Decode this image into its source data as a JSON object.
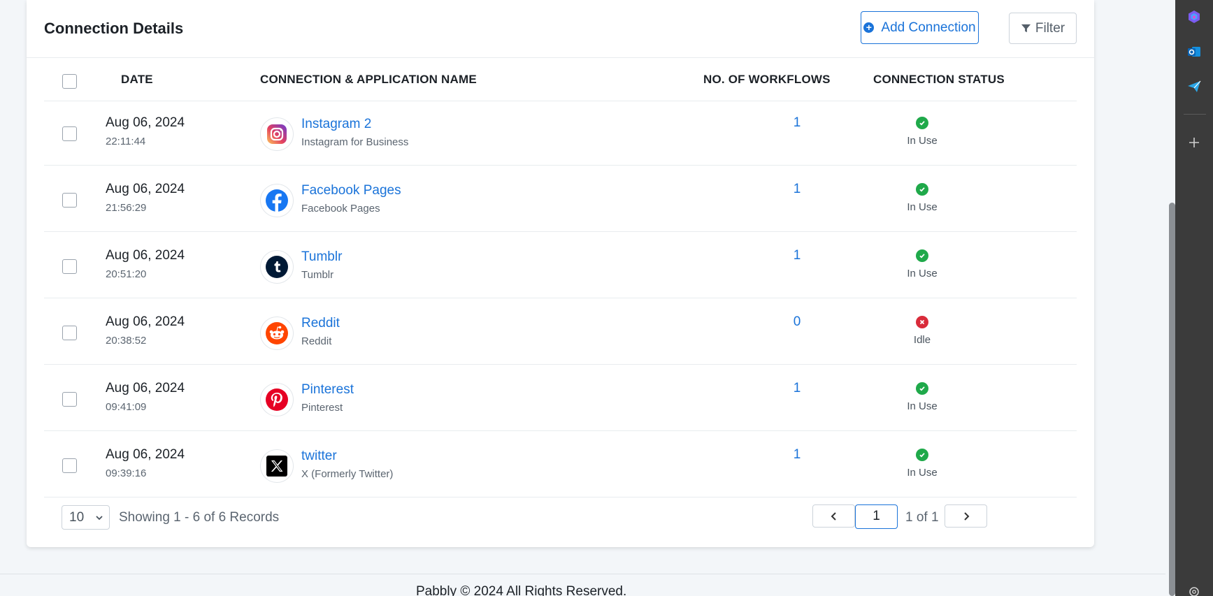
{
  "header": {
    "title": "Connection Details",
    "add_label": "Add Connection",
    "filter_label": "Filter"
  },
  "table": {
    "columns": [
      "DATE",
      "CONNECTION & APPLICATION NAME",
      "NO. OF WORKFLOWS",
      "CONNECTION STATUS"
    ],
    "rows": [
      {
        "date": "Aug 06, 2024",
        "time": "22:11:44",
        "name": "Instagram 2",
        "app": "Instagram for Business",
        "workflows": "1",
        "status": "In Use",
        "icon": "instagram-icon"
      },
      {
        "date": "Aug 06, 2024",
        "time": "21:56:29",
        "name": "Facebook Pages",
        "app": "Facebook Pages",
        "workflows": "1",
        "status": "In Use",
        "icon": "facebook-icon"
      },
      {
        "date": "Aug 06, 2024",
        "time": "20:51:20",
        "name": "Tumblr",
        "app": "Tumblr",
        "workflows": "1",
        "status": "In Use",
        "icon": "tumblr-icon"
      },
      {
        "date": "Aug 06, 2024",
        "time": "20:38:52",
        "name": "Reddit",
        "app": "Reddit",
        "workflows": "0",
        "status": "Idle",
        "icon": "reddit-icon"
      },
      {
        "date": "Aug 06, 2024",
        "time": "09:41:09",
        "name": "Pinterest",
        "app": "Pinterest",
        "workflows": "1",
        "status": "In Use",
        "icon": "pinterest-icon"
      },
      {
        "date": "Aug 06, 2024",
        "time": "09:39:16",
        "name": "twitter",
        "app": "X (Formerly Twitter)",
        "workflows": "1",
        "status": "In Use",
        "icon": "x-icon"
      }
    ]
  },
  "pagination": {
    "per_page": "10",
    "showing": "Showing 1 - 6 of 6 Records",
    "current_page": "1",
    "of_label": "1 of 1"
  },
  "footer": {
    "copyright": "Pabbly © 2024 All Rights Reserved."
  },
  "colors": {
    "accent": "#1a73d9",
    "in_use": "#1fa94a",
    "idle": "#d92b3a"
  }
}
